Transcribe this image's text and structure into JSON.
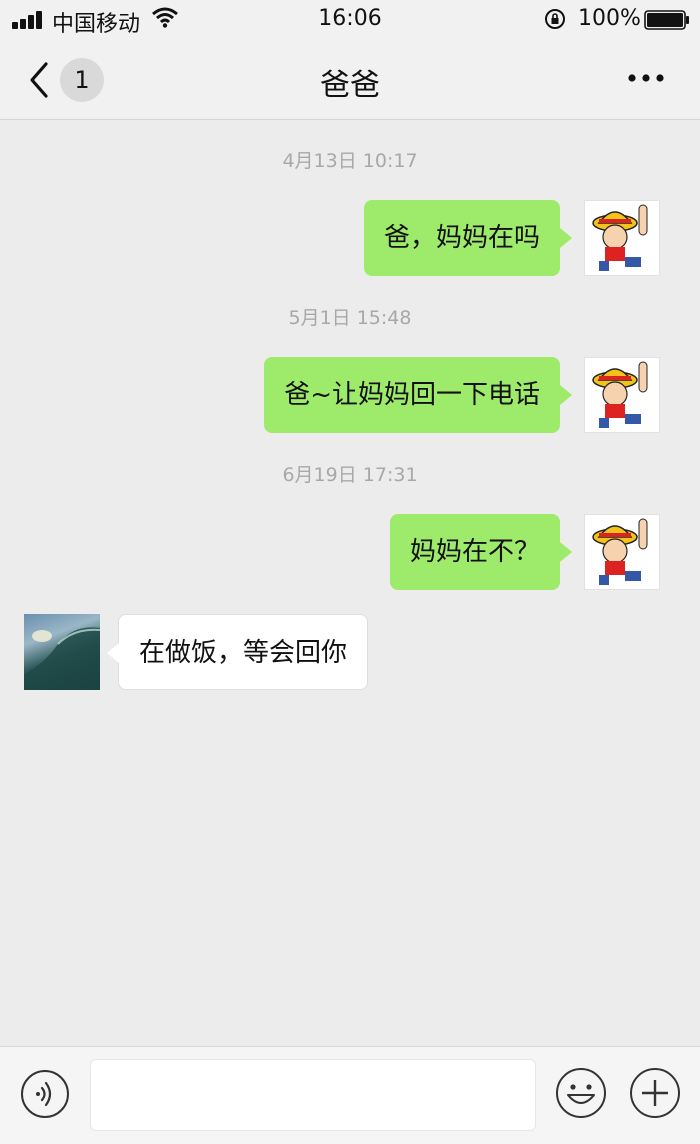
{
  "status_bar": {
    "carrier": "中国移动",
    "time": "16:06",
    "battery": "100%"
  },
  "nav": {
    "back_icon": "chevron-left-icon",
    "unread_count": "1",
    "title": "爸爸",
    "more_icon": "ellipsis-icon"
  },
  "messages": [
    {
      "type": "timestamp",
      "text": "4月13日 10:17"
    },
    {
      "type": "sent",
      "text": "爸，妈妈在吗"
    },
    {
      "type": "timestamp",
      "text": "5月1日 15:48"
    },
    {
      "type": "sent",
      "text": "爸~让妈妈回一下电话"
    },
    {
      "type": "timestamp",
      "text": "6月19日 17:31"
    },
    {
      "type": "sent",
      "text": "妈妈在不？"
    },
    {
      "type": "received",
      "text": "在做饭，等会回你"
    }
  ],
  "input_bar": {
    "voice_icon": "voice-icon",
    "text_value": "",
    "emoji_icon": "smiley-icon",
    "plus_icon": "plus-icon"
  },
  "colors": {
    "sent_bubble": "#9eea6a",
    "received_bubble": "#ffffff",
    "background": "#ececec"
  }
}
